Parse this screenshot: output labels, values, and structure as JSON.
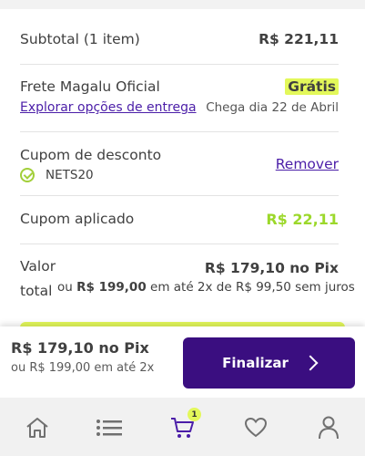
{
  "subtotal": {
    "label": "Subtotal (1 item)",
    "value": "R$ 221,11"
  },
  "shipping": {
    "label": "Frete Magalu Oficial",
    "price": "Grátis",
    "explore_link": "Explorar opções de entrega",
    "arrival": "Chega dia 22 de Abril"
  },
  "coupon": {
    "label": "Cupom de desconto",
    "code": "NETS20",
    "remove_label": "Remover"
  },
  "applied": {
    "label": "Cupom aplicado",
    "value": "R$ 22,11"
  },
  "total": {
    "label_line1": "Valor",
    "label_line2": "total",
    "pix": "R$ 179,10 no Pix",
    "or_text": "ou",
    "alt_price": "R$ 199,00",
    "installments": "em até 2x de R$ 99,50 sem juros"
  },
  "footer": {
    "pix": "R$ 179,10 no Pix",
    "installments": "ou R$ 199,00 em até 2x",
    "finish_label": "Finalizar"
  },
  "nav": {
    "items": [
      "home-icon",
      "menu-icon",
      "cart-icon",
      "heart-icon",
      "user-icon"
    ],
    "cart_count": "1"
  },
  "colors": {
    "accent": "#3a0e80",
    "highlight": "#e3f85a",
    "discount": "#9cd82b",
    "active_nav": "#4b1ea8"
  }
}
